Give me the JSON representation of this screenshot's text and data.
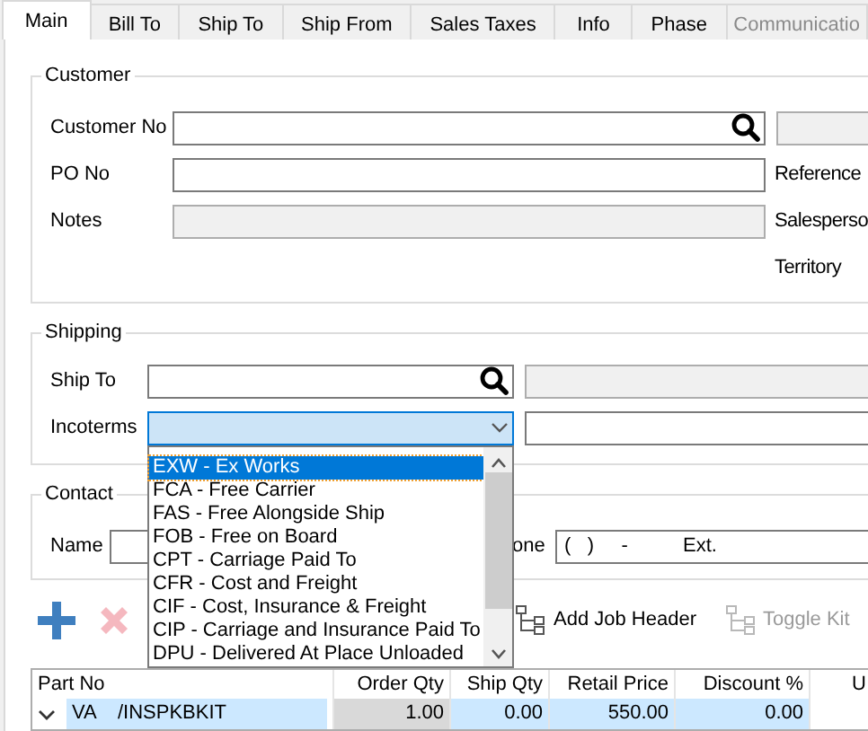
{
  "tabs": [
    {
      "label": "Main",
      "selected": true,
      "disabled": false
    },
    {
      "label": "Bill To",
      "selected": false,
      "disabled": false
    },
    {
      "label": "Ship To",
      "selected": false,
      "disabled": false
    },
    {
      "label": "Ship From",
      "selected": false,
      "disabled": false
    },
    {
      "label": "Sales Taxes",
      "selected": false,
      "disabled": false
    },
    {
      "label": "Info",
      "selected": false,
      "disabled": false
    },
    {
      "label": "Phase",
      "selected": false,
      "disabled": false
    },
    {
      "label": "Communicatio",
      "selected": false,
      "disabled": true
    }
  ],
  "customer": {
    "title": "Customer",
    "rows": [
      {
        "label": "Customer No",
        "kind": "lookup"
      },
      {
        "label": "PO No",
        "kind": "text",
        "side_label": "Reference"
      },
      {
        "label": "Notes",
        "kind": "readonly",
        "side_label": "Salesperso"
      },
      {
        "side_label": "Territory"
      }
    ]
  },
  "shipping": {
    "title": "Shipping",
    "rows": [
      {
        "label": "Ship To",
        "kind": "lookup"
      },
      {
        "label": "Incoterms",
        "kind": "dropdown",
        "expanded": true,
        "options": [
          {
            "label": "EXW - Ex Works",
            "selected": true
          },
          {
            "label": "FCA - Free Carrier",
            "selected": false
          },
          {
            "label": "FAS - Free Alongside Ship",
            "selected": false
          },
          {
            "label": "FOB - Free on Board",
            "selected": false
          },
          {
            "label": "CPT - Carriage Paid To",
            "selected": false
          },
          {
            "label": "CFR - Cost and Freight",
            "selected": false
          },
          {
            "label": "CIF - Cost, Insurance & Freight",
            "selected": false
          },
          {
            "label": "CIP - Carriage and Insurance Paid To",
            "selected": false
          },
          {
            "label": "DPU - Delivered At Place Unloaded",
            "selected": false
          }
        ]
      }
    ]
  },
  "contact": {
    "title": "Contact",
    "name_label": "Name",
    "phone_label": "one",
    "phone_value": "(   )     -          Ext."
  },
  "toolbar": [
    {
      "kind": "add",
      "disabled": false
    },
    {
      "kind": "delete",
      "disabled": true
    },
    {
      "kind": "tree",
      "label": "Add Job Header",
      "disabled": false
    },
    {
      "kind": "tree",
      "label": "Toggle Kit",
      "disabled": true
    }
  ],
  "grid": {
    "columns": [
      "Part No",
      "Order Qty",
      "Ship Qty",
      "Retail Price",
      "Discount %",
      "U"
    ],
    "rows": [
      {
        "expanded": true,
        "selected": true,
        "cells": [
          "VA    /INSPKBKIT",
          "1.00",
          "0.00",
          "550.00",
          "0.00"
        ]
      }
    ]
  }
}
